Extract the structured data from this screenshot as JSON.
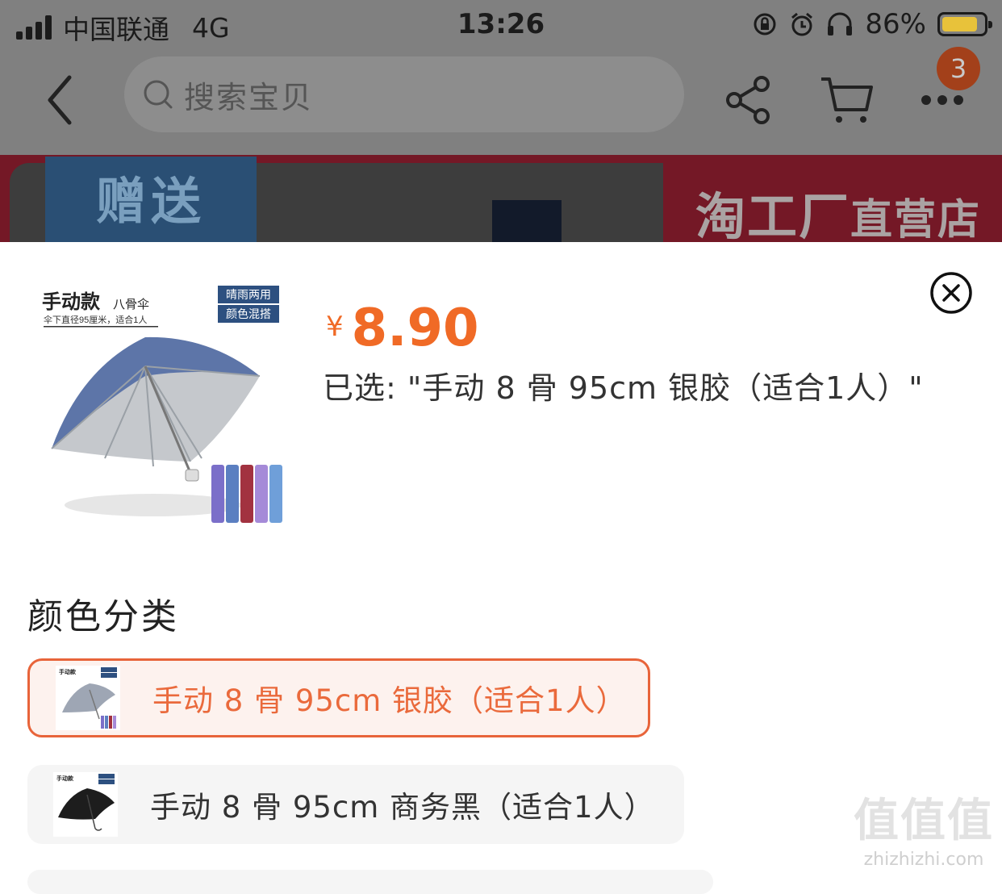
{
  "status_bar": {
    "carrier": "中国联通",
    "network": "4G",
    "time": "13:26",
    "battery_text": "86%",
    "battery_level": 0.86
  },
  "nav": {
    "search_placeholder": "搜索宝贝",
    "cart_badge": "3"
  },
  "banner": {
    "gift_text": "赠送",
    "store_text": "淘工厂",
    "store_suffix": "直营店"
  },
  "sku": {
    "currency": "¥",
    "price": "8.90",
    "selected_text": "已选: \"手动 8 骨 95cm 银胶（适合1人）\"",
    "category_title": "颜色分类",
    "product_image": {
      "title": "手动款",
      "subtitle": "八骨伞",
      "desc": "伞下直径95厘米，适合1人",
      "tag1": "晴雨两用",
      "tag2": "颜色混搭"
    },
    "options": [
      {
        "label": "手动 8 骨 95cm 银胶（适合1人）",
        "selected": true
      },
      {
        "label": "手动 8 骨 95cm 商务黑（适合1人）",
        "selected": false
      }
    ]
  },
  "watermark": {
    "big": "值值值",
    "small": "zhizhizhi.com"
  },
  "colors": {
    "accent": "#f06a26",
    "selected_border": "#e8643a",
    "overlay": "#808080"
  }
}
